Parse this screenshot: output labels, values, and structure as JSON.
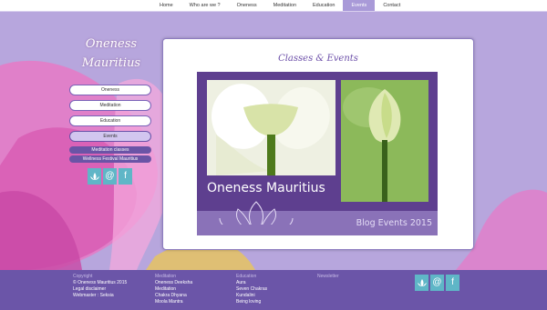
{
  "nav": {
    "items": [
      {
        "label": "Home"
      },
      {
        "label": "Who are we ?"
      },
      {
        "label": "Oneness"
      },
      {
        "label": "Meditation"
      },
      {
        "label": "Education"
      },
      {
        "label": "Events",
        "active": true
      },
      {
        "label": "Contact"
      }
    ]
  },
  "logo": {
    "line1": "Oneness",
    "line2": "Mauritius"
  },
  "sidebar": {
    "items": [
      {
        "label": "Oneness"
      },
      {
        "label": "Meditation"
      },
      {
        "label": "Education"
      },
      {
        "label": "Events",
        "current": true
      }
    ],
    "sub_items": [
      {
        "label": "Meditation classes"
      },
      {
        "label": "Wellness Festival Mauritius"
      }
    ],
    "social": [
      "lotus-icon",
      "at-icon",
      "facebook-icon"
    ]
  },
  "content": {
    "title": "Classes & Events",
    "banner_name": "Oneness Mauritius",
    "banner_subtitle": "Blog Events 2015"
  },
  "footer": {
    "copyright": {
      "heading": "Copyright",
      "lines": [
        "© Oneness Mauritius 2015",
        "Legal disclaimer",
        "Webmaster : Seksia"
      ]
    },
    "meditation": {
      "heading": "Meditation",
      "lines": [
        "Oneness Deeksha",
        "Meditation",
        "Chakra Dhyana",
        "Moola Mantra"
      ]
    },
    "education": {
      "heading": "Education",
      "lines": [
        "Aura",
        "Seven Chakras",
        "Kundalini",
        "Being loving"
      ]
    },
    "newsletter": {
      "heading": "Newsletter"
    }
  },
  "colors": {
    "accent": "#6b55a8",
    "background": "#b7a6dd",
    "social": "#5fb6c7"
  }
}
